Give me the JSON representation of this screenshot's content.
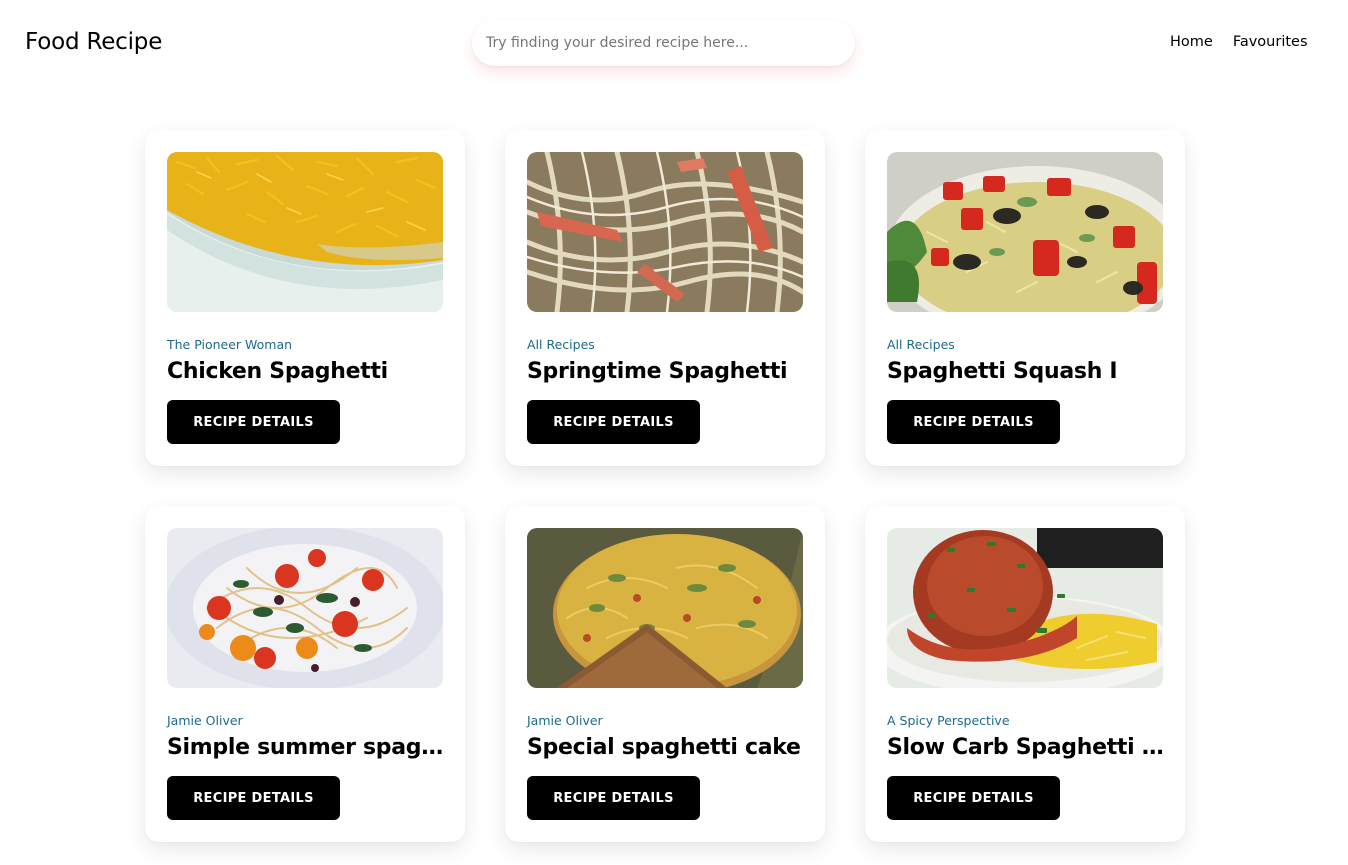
{
  "app": {
    "brand": "Food Recipe"
  },
  "search": {
    "placeholder": "Try finding your desired recipe here...",
    "value": ""
  },
  "nav": {
    "links": [
      "Home",
      "Favourites"
    ]
  },
  "colors": {
    "publisher": "#1d6a8a",
    "button_bg": "#000000",
    "button_text": "#ffffff"
  },
  "recipes": [
    {
      "publisher": "The Pioneer Woman",
      "title": "Chicken Spaghetti",
      "button": "RECIPE DETAILS",
      "image": "chicken-spaghetti-dish"
    },
    {
      "publisher": "All Recipes",
      "title": "Springtime Spaghetti",
      "button": "RECIPE DETAILS",
      "image": "springtime-spaghetti-noodles"
    },
    {
      "publisher": "All Recipes",
      "title": "Spaghetti Squash I",
      "button": "RECIPE DETAILS",
      "image": "spaghetti-squash-tomatoes"
    },
    {
      "publisher": "Jamie Oliver",
      "title": "Simple summer spagh...",
      "button": "RECIPE DETAILS",
      "image": "summer-spaghetti-cherry-tomatoes"
    },
    {
      "publisher": "Jamie Oliver",
      "title": "Special spaghetti cake",
      "button": "RECIPE DETAILS",
      "image": "spaghetti-cake-slice"
    },
    {
      "publisher": "A Spicy Perspective",
      "title": "Slow Carb Spaghetti a...",
      "button": "RECIPE DETAILS",
      "image": "meatball-squash-bowl"
    }
  ]
}
